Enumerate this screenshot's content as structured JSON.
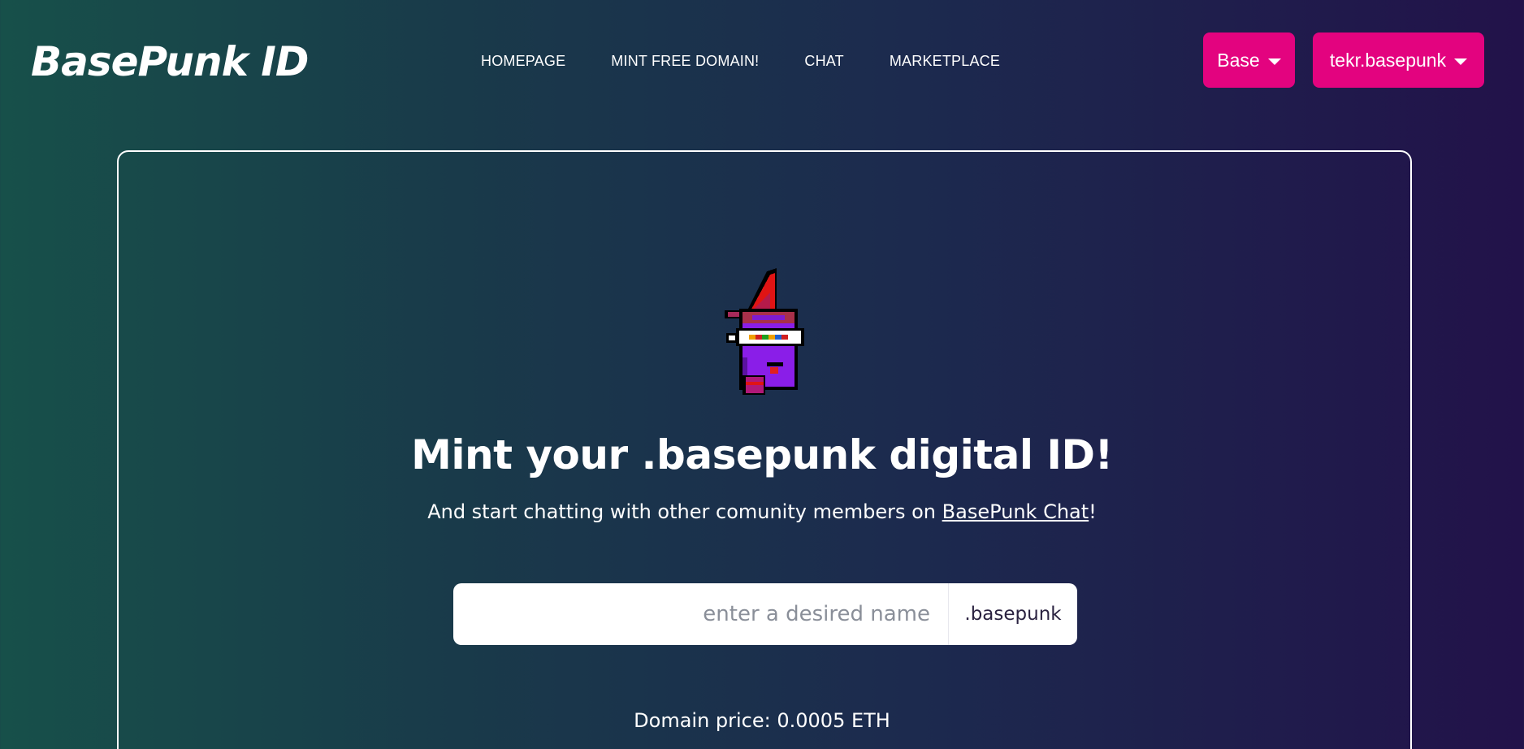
{
  "brand": {
    "title": "BasePunk ID"
  },
  "nav": {
    "items": [
      {
        "label": "HOMEPAGE"
      },
      {
        "label": "MINT FREE DOMAIN!"
      },
      {
        "label": "CHAT"
      },
      {
        "label": "MARKETPLACE"
      }
    ]
  },
  "wallet": {
    "network_label": "Base",
    "account_label": "tekr.basepunk"
  },
  "hero": {
    "title": "Mint your .basepunk digital ID!",
    "subtitle_prefix": "And start chatting with other comunity members on ",
    "subtitle_link": "BasePunk Chat",
    "subtitle_suffix": "!"
  },
  "mint_form": {
    "name_placeholder": "enter a desired name",
    "name_value": "",
    "tld_suffix": ".basepunk"
  },
  "pricing": {
    "price_text": "Domain price: 0.0005 ETH"
  },
  "colors": {
    "accent": "#e3037f",
    "bg_left": "#17504a",
    "bg_right": "#22124a"
  }
}
